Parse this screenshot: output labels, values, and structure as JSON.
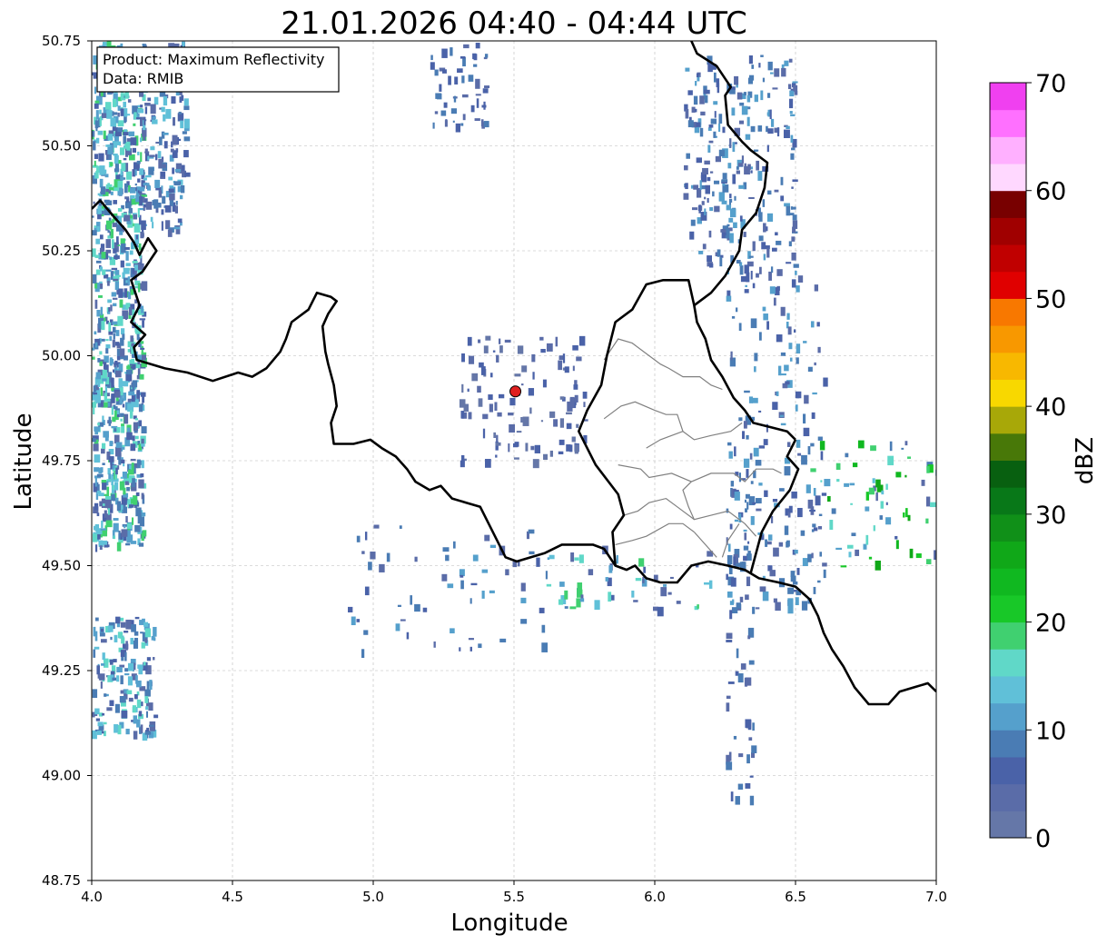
{
  "title": "21.01.2026 04:40 - 04:44 UTC",
  "info_box": {
    "product": "Product: Maximum Reflectivity",
    "data": "Data: RMIB"
  },
  "x_axis": {
    "label": "Longitude",
    "range": [
      4.0,
      7.0
    ],
    "ticks": [
      "4.0",
      "4.5",
      "5.0",
      "5.5",
      "6.0",
      "6.5",
      "7.0"
    ]
  },
  "y_axis": {
    "label": "Latitude",
    "range": [
      48.75,
      50.75
    ],
    "ticks": [
      "48.75",
      "49.00",
      "49.25",
      "49.50",
      "49.75",
      "50.00",
      "50.25",
      "50.50",
      "50.75"
    ]
  },
  "colorbar": {
    "label": "dBZ",
    "range": [
      0,
      70
    ],
    "ticks": [
      "0",
      "10",
      "20",
      "30",
      "40",
      "50",
      "60",
      "70"
    ],
    "colors": [
      "#6577a8",
      "#5a6ca8",
      "#4a62a8",
      "#4a7cb4",
      "#55a0cc",
      "#60c0d8",
      "#60d8c8",
      "#40d070",
      "#18c828",
      "#10b820",
      "#10a818",
      "#109018",
      "#087818",
      "#086010",
      "#487808",
      "#a8a808",
      "#f8d800",
      "#f8b800",
      "#f89800",
      "#f87800",
      "#e00000",
      "#c00000",
      "#a00000",
      "#780000",
      "#ffd8ff",
      "#ffb0ff",
      "#ff70ff",
      "#f040f0"
    ]
  },
  "grid": "on",
  "radar_site": {
    "lon": 5.505,
    "lat": 49.915,
    "color": "#e02020"
  },
  "colors": {
    "background": "#ffffff",
    "national_border": "#000000",
    "district_border": "#808080",
    "low_echo": "#5570a8",
    "mid_echo": "#60c8d0"
  },
  "chart_data": {
    "type": "heatmap",
    "title": "21.01.2026 04:40 - 04:44 UTC",
    "xlabel": "Longitude",
    "ylabel": "Latitude",
    "xlim": [
      4.0,
      7.0
    ],
    "ylim": [
      48.75,
      50.75
    ],
    "value_label": "dBZ",
    "value_range": [
      0,
      70
    ],
    "borders": [
      [
        [
          4.0,
          50.35
        ],
        [
          4.03,
          50.37
        ],
        [
          4.08,
          50.33
        ],
        [
          4.12,
          50.3
        ],
        [
          4.15,
          50.27
        ],
        [
          4.17,
          50.24
        ],
        [
          4.2,
          50.28
        ],
        [
          4.23,
          50.25
        ],
        [
          4.18,
          50.2
        ],
        [
          4.14,
          50.18
        ],
        [
          4.17,
          50.12
        ],
        [
          4.14,
          50.08
        ],
        [
          4.19,
          50.05
        ],
        [
          4.15,
          50.02
        ],
        [
          4.16,
          49.99
        ],
        [
          4.26,
          49.97
        ],
        [
          4.34,
          49.96
        ],
        [
          4.43,
          49.94
        ],
        [
          4.52,
          49.96
        ],
        [
          4.57,
          49.95
        ],
        [
          4.62,
          49.97
        ],
        [
          4.67,
          50.01
        ],
        [
          4.69,
          50.04
        ],
        [
          4.71,
          50.08
        ],
        [
          4.77,
          50.11
        ],
        [
          4.8,
          50.15
        ],
        [
          4.85,
          50.14
        ],
        [
          4.87,
          50.13
        ],
        [
          4.84,
          50.1
        ],
        [
          4.82,
          50.07
        ],
        [
          4.83,
          50.01
        ],
        [
          4.84,
          49.98
        ],
        [
          4.86,
          49.93
        ],
        [
          4.87,
          49.88
        ],
        [
          4.85,
          49.84
        ],
        [
          4.86,
          49.79
        ],
        [
          4.93,
          49.79
        ],
        [
          4.99,
          49.8
        ],
        [
          5.03,
          49.78
        ],
        [
          5.08,
          49.76
        ],
        [
          5.12,
          49.73
        ],
        [
          5.15,
          49.7
        ],
        [
          5.2,
          49.68
        ],
        [
          5.24,
          49.69
        ],
        [
          5.28,
          49.66
        ],
        [
          5.33,
          49.65
        ],
        [
          5.38,
          49.64
        ],
        [
          5.41,
          49.6
        ],
        [
          5.44,
          49.56
        ],
        [
          5.47,
          49.52
        ],
        [
          5.51,
          49.51
        ],
        [
          5.56,
          49.52
        ],
        [
          5.61,
          49.53
        ],
        [
          5.67,
          49.55
        ],
        [
          5.73,
          49.55
        ],
        [
          5.78,
          49.55
        ],
        [
          5.82,
          49.54
        ],
        [
          5.86,
          49.5
        ],
        [
          5.9,
          49.49
        ],
        [
          5.93,
          49.5
        ],
        [
          5.97,
          49.47
        ],
        [
          6.02,
          49.46
        ],
        [
          6.08,
          49.46
        ],
        [
          6.13,
          49.5
        ],
        [
          6.19,
          49.51
        ],
        [
          6.26,
          49.5
        ],
        [
          6.32,
          49.49
        ],
        [
          6.37,
          49.47
        ],
        [
          6.44,
          49.46
        ],
        [
          6.5,
          49.45
        ],
        [
          6.55,
          49.42
        ],
        [
          6.58,
          49.38
        ],
        [
          6.6,
          49.34
        ],
        [
          6.63,
          49.3
        ],
        [
          6.67,
          49.26
        ],
        [
          6.71,
          49.21
        ],
        [
          6.76,
          49.17
        ],
        [
          6.83,
          49.17
        ],
        [
          6.87,
          49.2
        ],
        [
          6.92,
          49.21
        ],
        [
          6.97,
          49.22
        ],
        [
          7.0,
          49.2
        ]
      ],
      [
        [
          6.5,
          49.8
        ],
        [
          6.47,
          49.76
        ],
        [
          6.51,
          49.73
        ],
        [
          6.48,
          49.68
        ],
        [
          6.42,
          49.63
        ],
        [
          6.38,
          49.58
        ],
        [
          6.36,
          49.53
        ],
        [
          6.34,
          49.48
        ]
      ],
      [
        [
          6.5,
          49.8
        ],
        [
          6.47,
          49.82
        ],
        [
          6.41,
          49.83
        ],
        [
          6.35,
          49.84
        ],
        [
          6.32,
          49.87
        ],
        [
          6.28,
          49.9
        ],
        [
          6.24,
          49.95
        ],
        [
          6.2,
          49.99
        ],
        [
          6.18,
          50.04
        ],
        [
          6.15,
          50.08
        ],
        [
          6.14,
          50.12
        ],
        [
          6.12,
          50.18
        ],
        [
          6.03,
          50.18
        ],
        [
          5.97,
          50.17
        ],
        [
          5.92,
          50.11
        ],
        [
          5.86,
          50.08
        ],
        [
          5.83,
          50.0
        ],
        [
          5.81,
          49.93
        ],
        [
          5.76,
          49.87
        ],
        [
          5.73,
          49.82
        ],
        [
          5.79,
          49.74
        ],
        [
          5.87,
          49.67
        ],
        [
          5.89,
          49.62
        ],
        [
          5.85,
          49.58
        ],
        [
          5.86,
          49.5
        ]
      ],
      [
        [
          6.14,
          50.12
        ],
        [
          6.2,
          50.15
        ],
        [
          6.25,
          50.19
        ],
        [
          6.3,
          50.25
        ],
        [
          6.31,
          50.3
        ],
        [
          6.36,
          50.34
        ],
        [
          6.39,
          50.4
        ],
        [
          6.4,
          50.46
        ],
        [
          6.34,
          50.49
        ],
        [
          6.31,
          50.51
        ],
        [
          6.26,
          50.55
        ],
        [
          6.25,
          50.62
        ],
        [
          6.27,
          50.64
        ],
        [
          6.22,
          50.69
        ],
        [
          6.15,
          50.72
        ],
        [
          6.13,
          50.75
        ]
      ]
    ],
    "district_borders": [
      [
        [
          5.82,
          49.99
        ],
        [
          5.87,
          50.04
        ],
        [
          5.92,
          50.03
        ],
        [
          5.96,
          50.01
        ],
        [
          6.02,
          49.98
        ],
        [
          6.05,
          49.97
        ],
        [
          6.1,
          49.95
        ],
        [
          6.16,
          49.95
        ],
        [
          6.2,
          49.93
        ],
        [
          6.24,
          49.92
        ]
      ],
      [
        [
          5.82,
          49.85
        ],
        [
          5.88,
          49.88
        ],
        [
          5.93,
          49.89
        ],
        [
          6.0,
          49.87
        ],
        [
          6.04,
          49.86
        ],
        [
          6.08,
          49.86
        ],
        [
          6.1,
          49.82
        ],
        [
          6.14,
          49.8
        ],
        [
          6.2,
          49.81
        ],
        [
          6.27,
          49.82
        ],
        [
          6.31,
          49.84
        ]
      ],
      [
        [
          5.97,
          49.78
        ],
        [
          6.02,
          49.8
        ],
        [
          6.1,
          49.82
        ]
      ],
      [
        [
          5.87,
          49.74
        ],
        [
          5.95,
          49.73
        ],
        [
          5.98,
          49.71
        ],
        [
          6.06,
          49.72
        ],
        [
          6.13,
          49.7
        ],
        [
          6.2,
          49.72
        ],
        [
          6.28,
          49.72
        ],
        [
          6.32,
          49.7
        ],
        [
          6.36,
          49.73
        ],
        [
          6.42,
          49.73
        ],
        [
          6.45,
          49.72
        ]
      ],
      [
        [
          5.89,
          49.62
        ],
        [
          5.94,
          49.63
        ],
        [
          5.98,
          49.65
        ],
        [
          6.04,
          49.66
        ],
        [
          6.08,
          49.64
        ],
        [
          6.14,
          49.61
        ],
        [
          6.2,
          49.62
        ],
        [
          6.26,
          49.63
        ],
        [
          6.32,
          49.6
        ],
        [
          6.36,
          49.57
        ]
      ],
      [
        [
          5.86,
          49.55
        ],
        [
          5.92,
          49.56
        ],
        [
          5.97,
          49.57
        ],
        [
          6.05,
          49.6
        ],
        [
          6.1,
          49.6
        ],
        [
          6.14,
          49.58
        ]
      ],
      [
        [
          6.14,
          49.58
        ],
        [
          6.18,
          49.55
        ],
        [
          6.22,
          49.52
        ]
      ],
      [
        [
          6.3,
          49.6
        ],
        [
          6.26,
          49.56
        ],
        [
          6.24,
          49.52
        ]
      ],
      [
        [
          6.13,
          49.7
        ],
        [
          6.1,
          49.68
        ],
        [
          6.12,
          49.64
        ],
        [
          6.14,
          49.61
        ]
      ]
    ]
  }
}
